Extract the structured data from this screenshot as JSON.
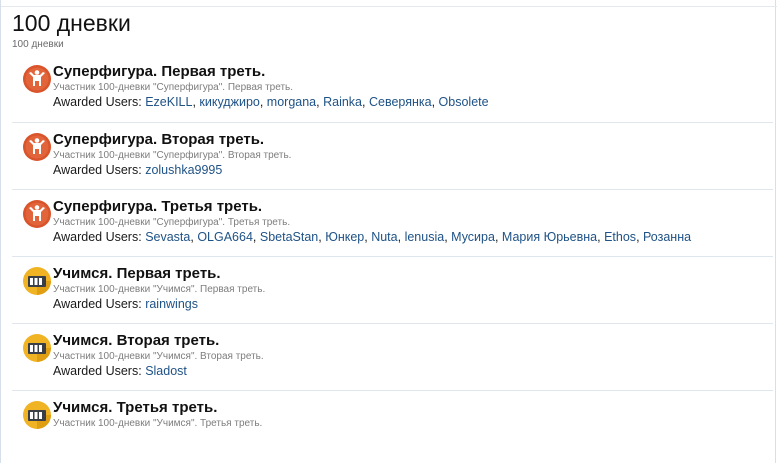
{
  "page": {
    "title": "100 дневки",
    "subtitle": "100 дневки"
  },
  "awarded_label": "Awarded Users:",
  "separator": ", ",
  "awards": [
    {
      "icon": "figure-badge-icon",
      "title": "Суперфигура. Первая треть.",
      "description": "Участник 100-дневки \"Суперфигура\". Первая треть.",
      "users": [
        "EzeKILL",
        "кикуджиро",
        "morgana",
        "Rainka",
        "Северянка",
        "Obsolete"
      ]
    },
    {
      "icon": "figure-badge-icon",
      "title": "Суперфигура. Вторая треть.",
      "description": "Участник 100-дневки \"Суперфигура\". Вторая треть.",
      "users": [
        "zolushka9995"
      ]
    },
    {
      "icon": "figure-badge-icon",
      "title": "Суперфигура. Третья треть.",
      "description": "Участник 100-дневки \"Суперфигура\". Третья треть.",
      "users": [
        "Sevasta",
        "OLGA664",
        "SbetaStan",
        "Юнкер",
        "Nuta",
        "lenusia",
        "Мусира",
        "Мария Юрьевна",
        "Ethos",
        "Розанна"
      ]
    },
    {
      "icon": "study-badge-icon",
      "title": "Учимся. Первая треть.",
      "description": "Участник 100-дневки \"Учимся\". Первая треть.",
      "users": [
        "rainwings"
      ]
    },
    {
      "icon": "study-badge-icon",
      "title": "Учимся. Вторая треть.",
      "description": "Участник 100-дневки \"Учимся\". Вторая треть.",
      "users": [
        "Sladost"
      ]
    },
    {
      "icon": "study-badge-icon",
      "title": "Учимся. Третья треть.",
      "description": "Участник 100-дневки \"Учимся\". Третья треть.",
      "users": []
    }
  ],
  "colors": {
    "link": "#1f5286",
    "figure_badge": "#d9532b",
    "study_badge": "#f0b323",
    "divider": "#dfe6ee"
  }
}
